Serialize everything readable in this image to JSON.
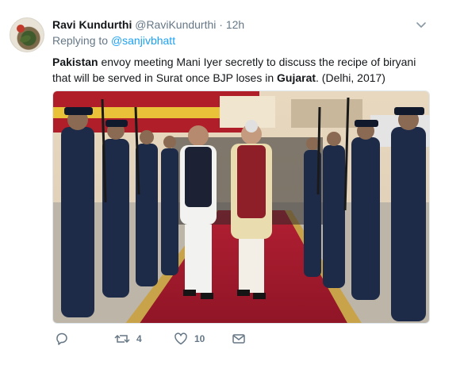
{
  "tweet": {
    "author_name": "Ravi Kundurthi",
    "author_handle": "@RaviKundurthi",
    "separator": "·",
    "time": "12h",
    "replying_prefix": "Replying to",
    "replying_to": "@sanjivbhatt",
    "text_part1_bold": "Pakistan",
    "text_part2": " envoy meeting Mani Iyer secretly to discuss the recipe of biryani that will be served in Surat once BJP loses in ",
    "text_part3_bold": "Gujarat",
    "text_part4": ". (Delhi, 2017)"
  },
  "actions": {
    "reply_icon": "reply-icon",
    "retweet_icon": "retweet-icon",
    "retweet_count": "4",
    "like_icon": "heart-icon",
    "like_count": "10",
    "dm_icon": "envelope-icon"
  },
  "colors": {
    "link": "#1da1f2",
    "muted": "#657786",
    "text": "#14171a"
  }
}
